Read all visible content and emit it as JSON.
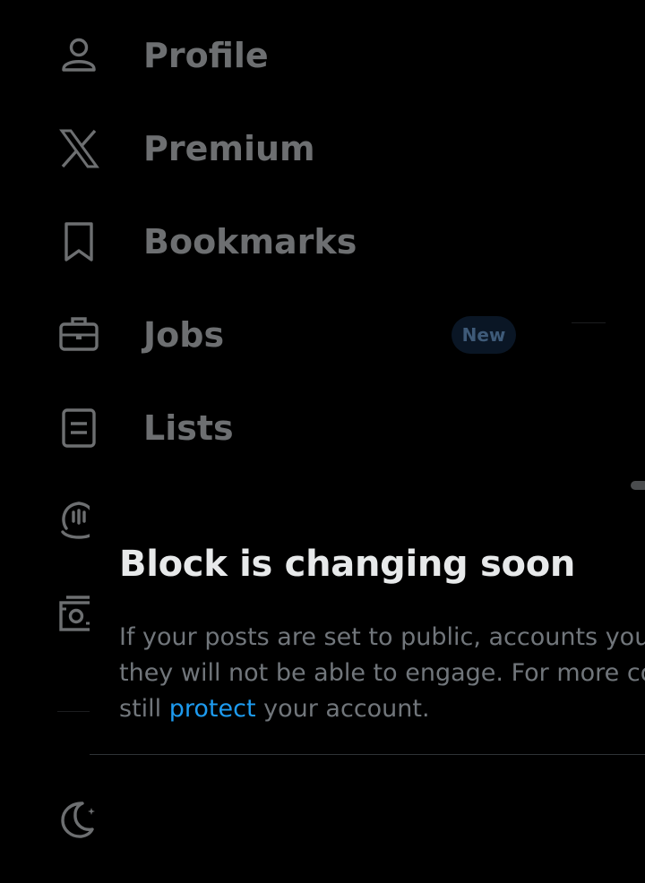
{
  "nav": {
    "items": [
      {
        "label": "Profile",
        "icon": "person-icon"
      },
      {
        "label": "Premium",
        "icon": "x-logo-icon"
      },
      {
        "label": "Bookmarks",
        "icon": "bookmark-icon"
      },
      {
        "label": "Jobs",
        "icon": "briefcase-icon",
        "badge": "New"
      },
      {
        "label": "Lists",
        "icon": "list-document-icon"
      },
      {
        "label": "",
        "icon": "spaces-icon"
      },
      {
        "label": "",
        "icon": "monetization-icon"
      }
    ],
    "theme_icon": "moon-icon"
  },
  "notice": {
    "title": "Block is changing soon",
    "line1": "If your posts are set to public, accounts you",
    "line2": "they will not be able to engage. For more co",
    "line3_pre": "still ",
    "line3_link": "protect",
    "line3_post": " your account."
  },
  "colors": {
    "background": "#000000",
    "nav_text_dimmed": "#6d6f71",
    "title_text": "#e7e9ea",
    "body_text": "#71767b",
    "link": "#1d9bf0",
    "badge_bg": "#0a1625",
    "badge_text": "#3e5a78"
  }
}
